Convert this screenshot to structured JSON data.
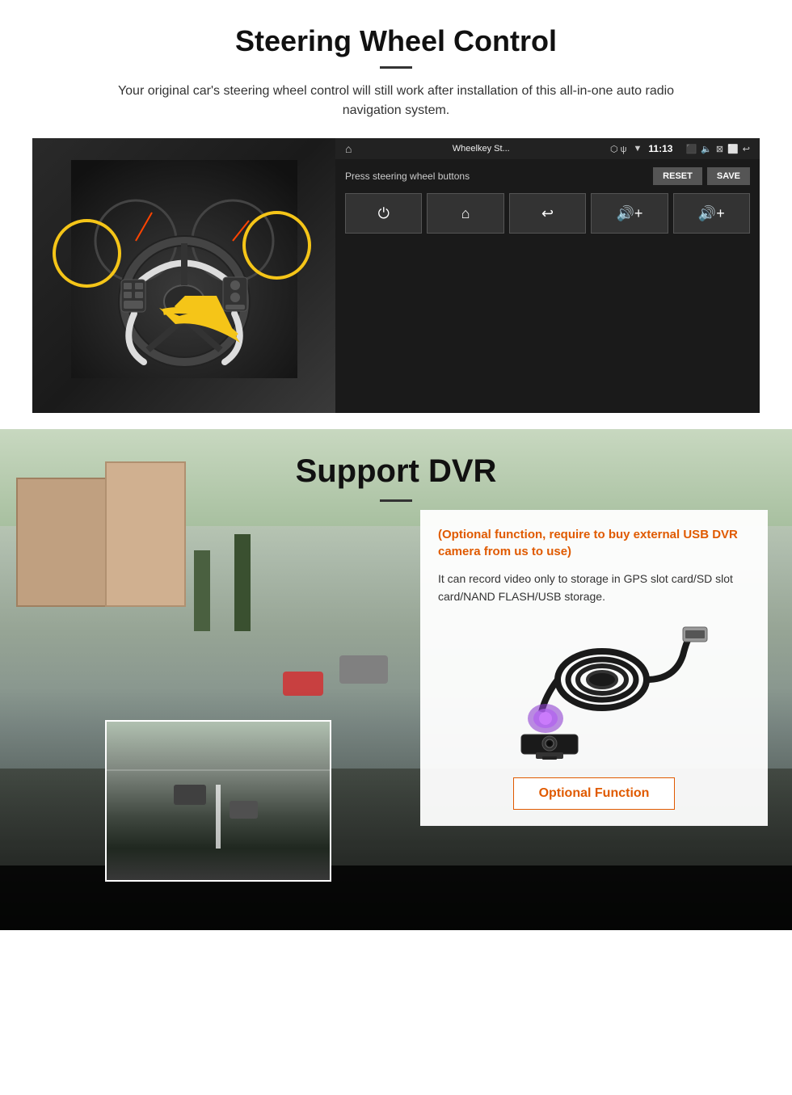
{
  "steering": {
    "title": "Steering Wheel Control",
    "subtitle": "Your original car's steering wheel control will still work after installation of this all-in-one auto radio navigation system.",
    "android": {
      "app_title": "Wheelkey St... ",
      "time": "11:13",
      "instruction": "Press steering wheel buttons",
      "reset_label": "RESET",
      "save_label": "SAVE",
      "controls": [
        "⏻",
        "⌂",
        "↩",
        "🔊+",
        "🔊+"
      ]
    }
  },
  "dvr": {
    "title": "Support DVR",
    "optional_note": "(Optional function, require to buy external USB DVR camera from us to use)",
    "description": "It can record video only to storage in GPS slot card/SD slot card/NAND FLASH/USB storage.",
    "optional_function_label": "Optional Function"
  }
}
